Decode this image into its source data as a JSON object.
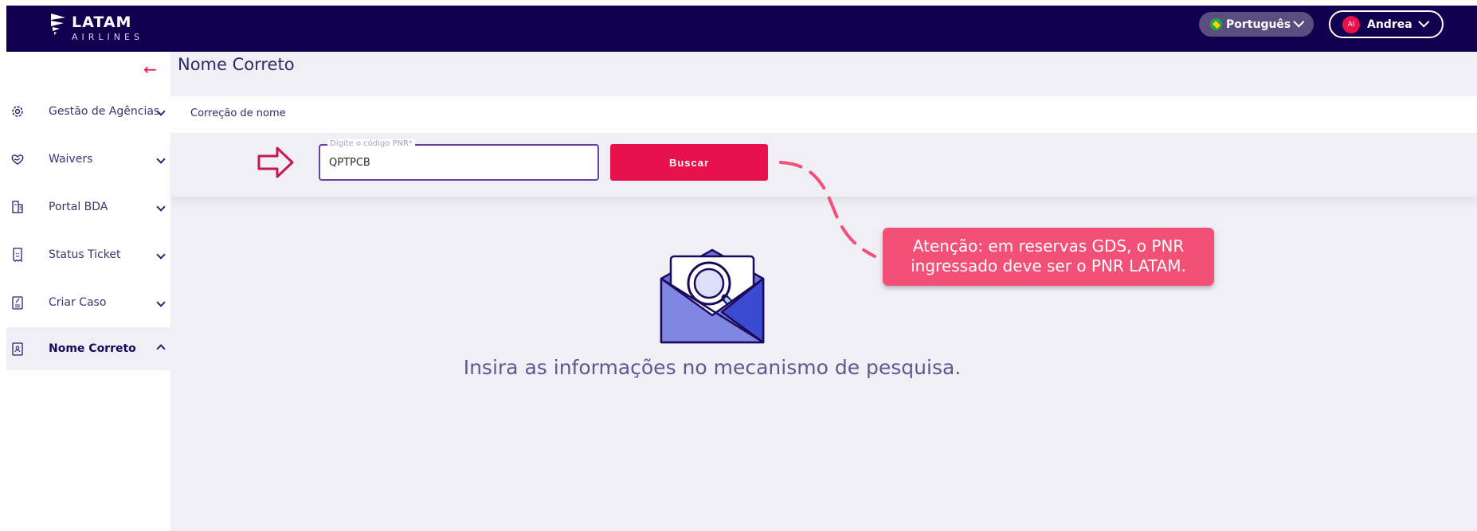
{
  "brand": {
    "name": "LATAM",
    "sub": "AIRLINES"
  },
  "header": {
    "language": "Português",
    "user_initials": "AI",
    "user_name": "Andrea"
  },
  "sidebar": {
    "items": [
      {
        "label": "Gestão de Agências",
        "icon": "gear-icon"
      },
      {
        "label": "Waivers",
        "icon": "heart-hand-icon"
      },
      {
        "label": "Portal BDA",
        "icon": "document-icon"
      },
      {
        "label": "Status Ticket",
        "icon": "ticket-icon"
      },
      {
        "label": "Criar Caso",
        "icon": "clipboard-icon"
      },
      {
        "label": "Nome Correto",
        "icon": "badge-icon",
        "active": true
      }
    ]
  },
  "main": {
    "title": "Nome Correto",
    "card_header": "Correção de nome",
    "pnr_field": {
      "label": "Digite o código PNR*",
      "value": "QPTPCB"
    },
    "search_button": "Buscar",
    "callout_line1": "Atenção: em reservas GDS, o PNR",
    "callout_line2": "ingressado deve ser o PNR LATAM.",
    "empty_message": "Insira as informações no mecanismo de pesquisa."
  },
  "colors": {
    "topbar": "#10004f",
    "accent": "#e8114b",
    "callout": "#f25076",
    "field_border": "#6b3fa0"
  }
}
